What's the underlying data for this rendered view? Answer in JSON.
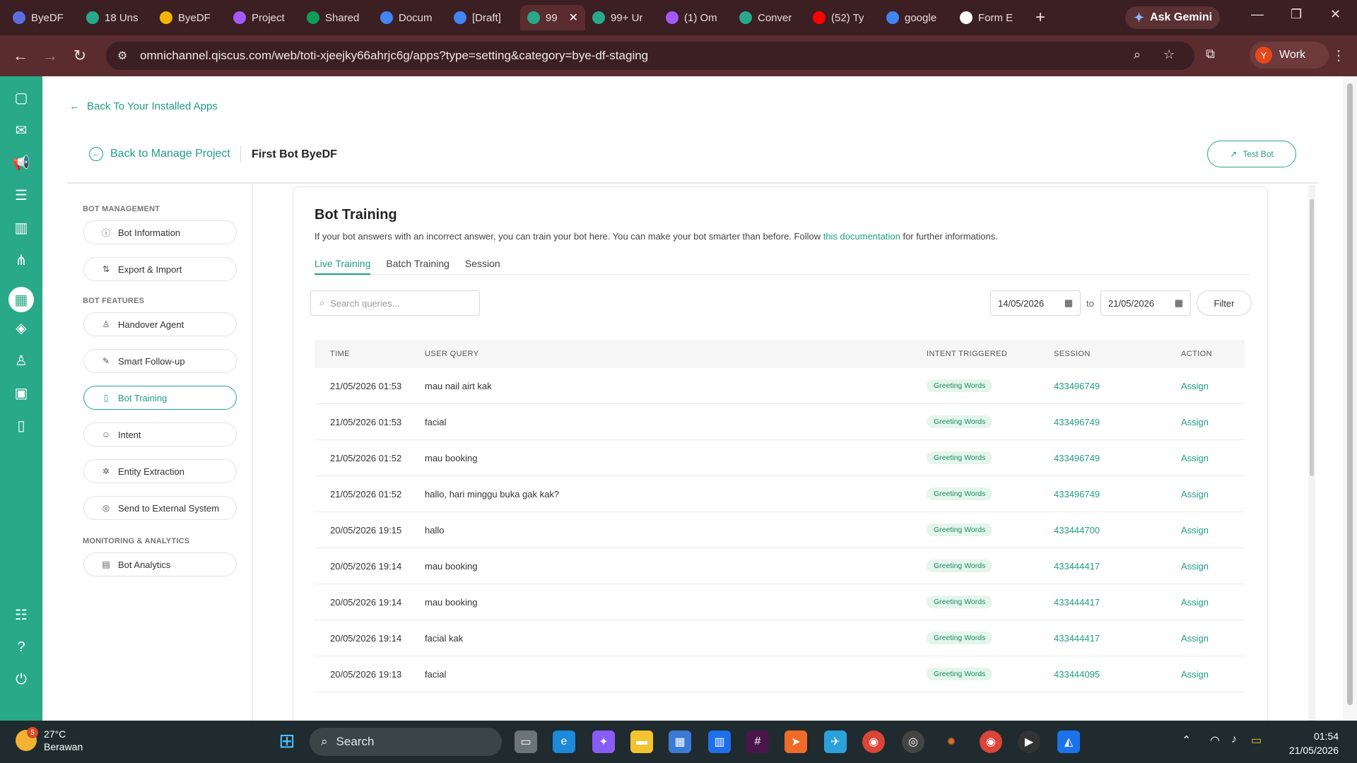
{
  "browser": {
    "tabs": [
      {
        "title": "ByeDF",
        "color": "#5b6ee1",
        "icon": "doc-icon"
      },
      {
        "title": "18 Uns",
        "color": "#27a98a",
        "icon": "qiscus-icon"
      },
      {
        "title": "ByeDF",
        "color": "#f4b400",
        "icon": "drive-icon"
      },
      {
        "title": "Project",
        "color": "#a259ff",
        "icon": "figma-icon"
      },
      {
        "title": "Shared",
        "color": "#0f9d58",
        "icon": "drive-icon"
      },
      {
        "title": "Docum",
        "color": "#4285f4",
        "icon": "docs-icon"
      },
      {
        "title": "[Draft]",
        "color": "#4285f4",
        "icon": "docs-icon"
      },
      {
        "title": "99",
        "color": "#27a98a",
        "icon": "qiscus-icon",
        "active": true
      },
      {
        "title": "99+ Ur",
        "color": "#27a98a",
        "icon": "qiscus-icon"
      },
      {
        "title": "(1) Om",
        "color": "#a259ff",
        "icon": "figma-icon"
      },
      {
        "title": "Conver",
        "color": "#27a98a",
        "icon": "qiscus-icon"
      },
      {
        "title": "(52) Ty",
        "color": "#ff0000",
        "icon": "youtube-icon"
      },
      {
        "title": "google",
        "color": "#4285f4",
        "icon": "google-icon"
      },
      {
        "title": "Form E",
        "color": "#ffffff",
        "icon": "openai-icon"
      }
    ],
    "gemini_label": "Ask Gemini",
    "url": "omnichannel.qiscus.com/web/toti-xjeejky66ahrjc6g/apps?type=setting&category=bye-df-staging",
    "profile_initial": "Y",
    "profile_label": "Work"
  },
  "header": {
    "back_installed": "Back To Your Installed Apps",
    "back_manage": "Back to Manage Project",
    "bot_name": "First Bot ByeDF",
    "test_bot": "Test Bot"
  },
  "sidebar": {
    "section_management": "BOT MANAGEMENT",
    "section_features": "BOT FEATURES",
    "section_monitoring": "MONITORING & ANALYTICS",
    "items": {
      "bot_information": "Bot Information",
      "export_import": "Export & Import",
      "handover_agent": "Handover Agent",
      "smart_followup": "Smart Follow-up",
      "bot_training": "Bot Training",
      "intent": "Intent",
      "entity_extraction": "Entity Extraction",
      "send_external": "Send to External System",
      "bot_analytics": "Bot Analytics"
    }
  },
  "main": {
    "title": "Bot Training",
    "desc_before": "If your bot answers with an incorrect answer, you can train your bot here. You can make your bot smarter than before. Follow ",
    "desc_link": "this documentation",
    "desc_after": " for further informations.",
    "tabs": {
      "live": "Live Training",
      "batch": "Batch Training",
      "session": "Session"
    },
    "search_placeholder": "Search queries...",
    "date_from": "14/05/2026",
    "date_to": "21/05/2026",
    "to_label": "to",
    "filter_label": "Filter",
    "columns": {
      "time": "TIME",
      "query": "USER QUERY",
      "intent": "INTENT TRIGGERED",
      "session": "SESSION",
      "action": "ACTION"
    },
    "rows": [
      {
        "time": "21/05/2026 01:53",
        "query": "mau nail airt kak",
        "intent": "Greeting Words",
        "session": "433496749",
        "action": "Assign"
      },
      {
        "time": "21/05/2026 01:53",
        "query": "facial",
        "intent": "Greeting Words",
        "session": "433496749",
        "action": "Assign"
      },
      {
        "time": "21/05/2026 01:52",
        "query": "mau booking",
        "intent": "Greeting Words",
        "session": "433496749",
        "action": "Assign"
      },
      {
        "time": "21/05/2026 01:52",
        "query": "hallo, hari minggu buka gak kak?",
        "intent": "Greeting Words",
        "session": "433496749",
        "action": "Assign"
      },
      {
        "time": "20/05/2026 19:15",
        "query": "hallo",
        "intent": "Greeting Words",
        "session": "433444700",
        "action": "Assign"
      },
      {
        "time": "20/05/2026 19:14",
        "query": "mau booking",
        "intent": "Greeting Words",
        "session": "433444417",
        "action": "Assign"
      },
      {
        "time": "20/05/2026 19:14",
        "query": "mau booking",
        "intent": "Greeting Words",
        "session": "433444417",
        "action": "Assign"
      },
      {
        "time": "20/05/2026 19:14",
        "query": "facial kak",
        "intent": "Greeting Words",
        "session": "433444417",
        "action": "Assign"
      },
      {
        "time": "20/05/2026 19:13",
        "query": "facial",
        "intent": "Greeting Words",
        "session": "433444095",
        "action": "Assign"
      }
    ]
  },
  "taskbar": {
    "weather_temp": "27°C",
    "weather_desc": "Berawan",
    "weather_badge": "5",
    "search_label": "Search",
    "time": "01:54",
    "date": "21/05/2026"
  },
  "colors": {
    "accent": "#27a98a",
    "chrome_dark": "#3b1f22",
    "chrome_mid": "#5b2c2e"
  }
}
